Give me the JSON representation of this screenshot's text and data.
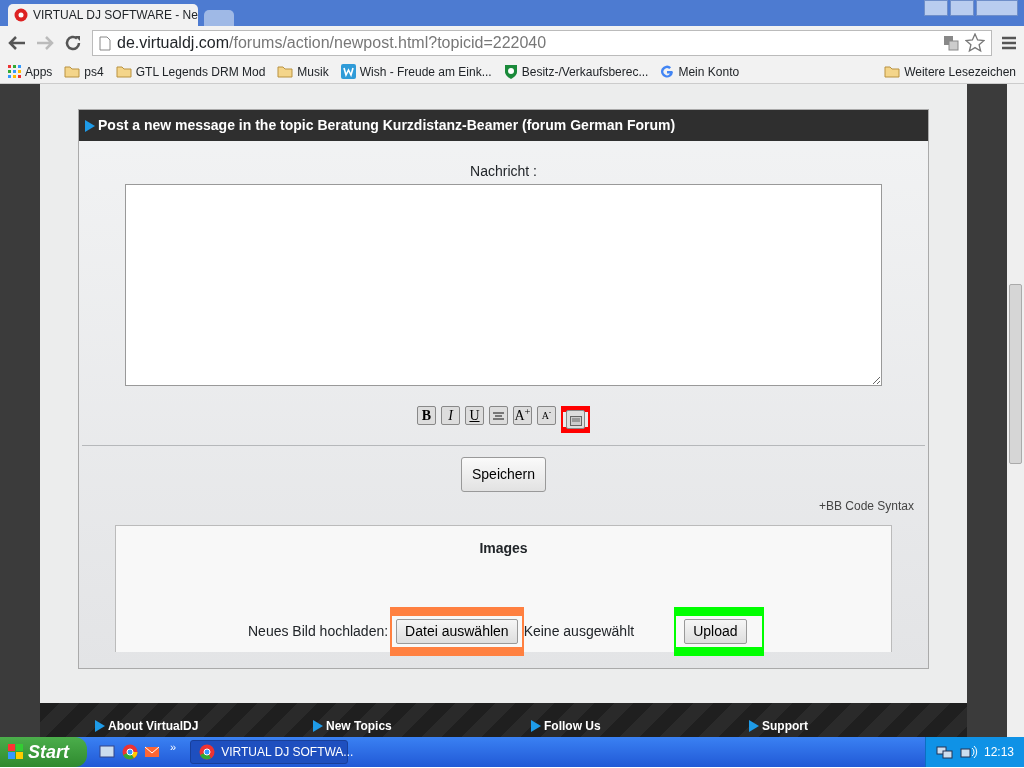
{
  "browser": {
    "tabs": [
      {
        "title": "VIRTUAL DJ SOFTWARE - Ne",
        "selected": true
      },
      {
        "selected": false
      }
    ],
    "url_host": "de.virtualdj.com",
    "url_path": "/forums/action/newpost.html?topicid=222040",
    "bookmarks": [
      {
        "kind": "apps",
        "label": "Apps"
      },
      {
        "kind": "folder",
        "label": "ps4"
      },
      {
        "kind": "folder",
        "label": "GTL Legends DRM Mod"
      },
      {
        "kind": "folder",
        "label": "Musik"
      },
      {
        "kind": "site",
        "label": "Wish - Freude am Eink..."
      },
      {
        "kind": "shield",
        "label": "Besitz-/Verkaufsberec..."
      },
      {
        "kind": "google",
        "label": "Mein Konto"
      }
    ],
    "other_bookmarks": "Weitere Lesezeichen"
  },
  "post": {
    "heading": "Post a new message in the topic Beratung Kurzdistanz-Beamer (forum German Forum)",
    "message_label": "Nachricht :",
    "format_buttons": [
      {
        "kind": "bold",
        "label": "B"
      },
      {
        "kind": "italic",
        "label": "I"
      },
      {
        "kind": "underline",
        "label": "U"
      },
      {
        "kind": "align"
      },
      {
        "kind": "larger",
        "label": "A$^{+}$"
      },
      {
        "kind": "smaller",
        "label": "A$^{-}$"
      },
      {
        "kind": "image",
        "color": "#ff0000"
      }
    ],
    "save_button": "Speichern",
    "bbcode_link": "+BB Code Syntax",
    "images": {
      "title": "Images",
      "upload_label": "Neues Bild hochladen:",
      "choose_button": {
        "label": "Datei auswählen",
        "color": "#ff8040"
      },
      "no_file": "Keine ausgewählt",
      "upload_button": {
        "label": "Upload",
        "color": "#00ff00"
      }
    }
  },
  "footer": [
    "About VirtualDJ",
    "New Topics",
    "Follow Us",
    "Support"
  ],
  "taskbar": {
    "start": "Start",
    "more": "»",
    "task": "VIRTUAL DJ SOFTWA...",
    "clock": "12:13"
  }
}
